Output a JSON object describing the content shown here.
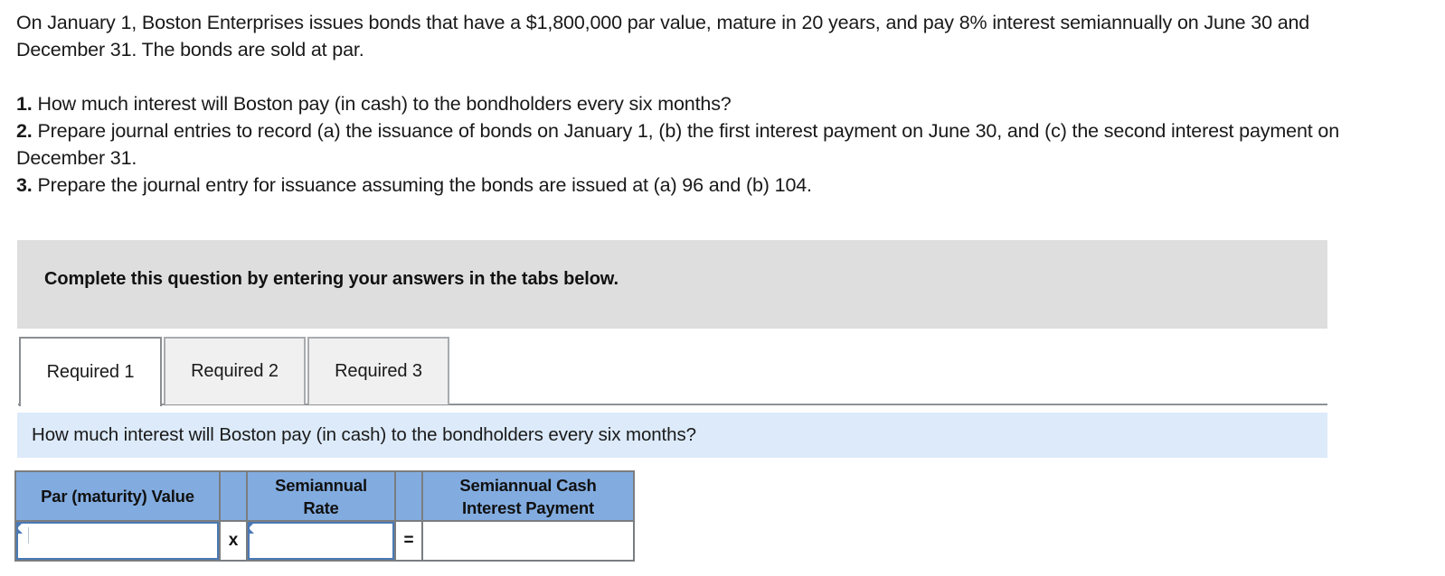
{
  "problem": {
    "stem_line_1": "On January 1, Boston Enterprises issues bonds that have a $1,800,000 par value, mature in 20 years, and pay 8% interest",
    "stem_line_2": "semiannually on June 30 and December 31. The bonds are sold at par.",
    "requirements": [
      {
        "number": "1.",
        "text": "How much interest will Boston pay (in cash) to the bondholders every six months?"
      },
      {
        "number": "2.",
        "text": "Prepare journal entries to record (a) the issuance of bonds on January 1, (b) the first interest payment on June 30, and (c) the second interest payment on December 31."
      },
      {
        "number": "3.",
        "text": "Prepare the journal entry for issuance assuming the bonds are issued at (a) 96 and (b) 104."
      }
    ]
  },
  "instruction_banner": {
    "text": "Complete this question by entering your answers in the tabs below.",
    "background_color": "#dedede"
  },
  "tabs": [
    {
      "label": "Required 1",
      "active": true
    },
    {
      "label": "Required 2",
      "active": false
    },
    {
      "label": "Required 3",
      "active": false
    }
  ],
  "question_bar": {
    "text": "How much interest will Boston pay (in cash) to the bondholders every six months?",
    "background_color": "#dceafa"
  },
  "answer_table": {
    "header_color": "#82ACE0",
    "headers": [
      "Par (maturity) Value",
      "",
      "Semiannual Rate",
      "",
      "Semiannual Cash Interest Payment"
    ],
    "header_cells": {
      "par_value": "Par (maturity) Value",
      "semiannual_rate_line1": "Semiannual",
      "semiannual_rate_line2": "Rate",
      "cash_payment_line1": "Semiannual Cash",
      "cash_payment_line2": "Interest Payment"
    },
    "operators": {
      "multiply": "x",
      "equals": "="
    },
    "row": {
      "par_value": "",
      "semiannual_rate": "",
      "semiannual_cash_interest_payment": ""
    },
    "placeholders": {
      "par_value": "",
      "semiannual_rate": "",
      "semiannual_cash_interest_payment": ""
    }
  }
}
